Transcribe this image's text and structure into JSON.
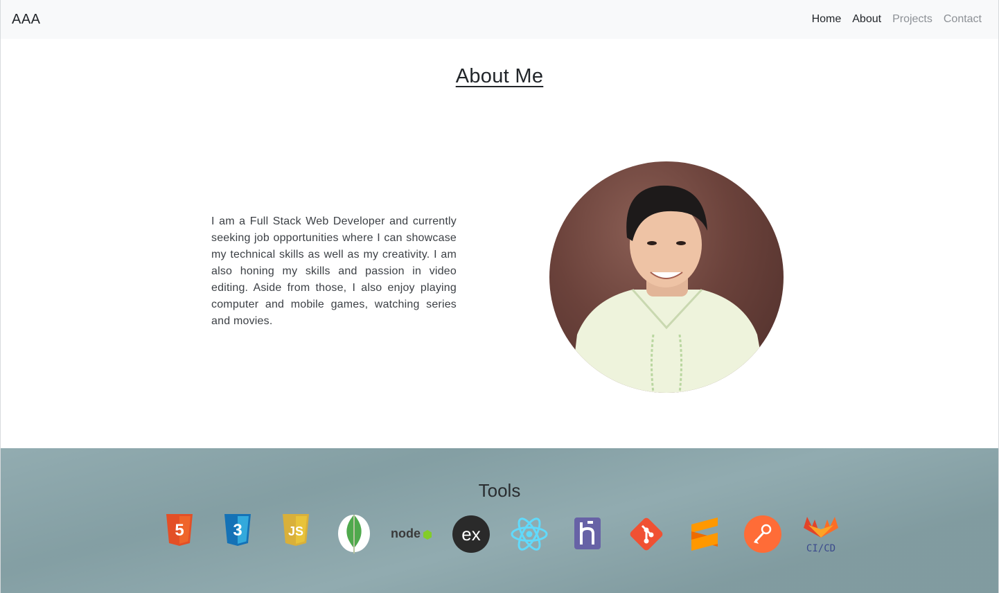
{
  "navbar": {
    "brand": "AAA",
    "links": [
      {
        "label": "Home",
        "active": true
      },
      {
        "label": "About",
        "active": true
      },
      {
        "label": "Projects",
        "active": false
      },
      {
        "label": "Contact",
        "active": false
      }
    ]
  },
  "about": {
    "title": "About Me",
    "paragraph": "I am a Full Stack Web Developer and currently seeking job opportunities where I can showcase my technical skills as well as my creativity. I am also honing my skills and passion in video editing. Aside from those, I also enjoy playing computer and mobile games, watching series and movies."
  },
  "tools": {
    "title": "Tools",
    "icons": [
      {
        "name": "html5-icon",
        "text": "5",
        "color": "#e34f26"
      },
      {
        "name": "css3-icon",
        "text": "3",
        "color": "#1572b6"
      },
      {
        "name": "javascript-icon",
        "text": "JS",
        "color": "#e8c33a"
      },
      {
        "name": "mongodb-icon",
        "color": "#4fa94d"
      },
      {
        "name": "nodejs-icon",
        "text": "node",
        "color": "#3c873a"
      },
      {
        "name": "express-icon",
        "text": "ex",
        "color": "#2a2a2a"
      },
      {
        "name": "react-icon",
        "color": "#61dafb"
      },
      {
        "name": "heroku-icon",
        "color": "#6762a6"
      },
      {
        "name": "git-icon",
        "color": "#f05133"
      },
      {
        "name": "sublime-text-icon",
        "color": "#ff9800"
      },
      {
        "name": "postman-icon",
        "color": "#ff6c37"
      },
      {
        "name": "gitlab-cicd-icon",
        "text": "CI/CD",
        "color": "#fc6d26"
      }
    ]
  }
}
